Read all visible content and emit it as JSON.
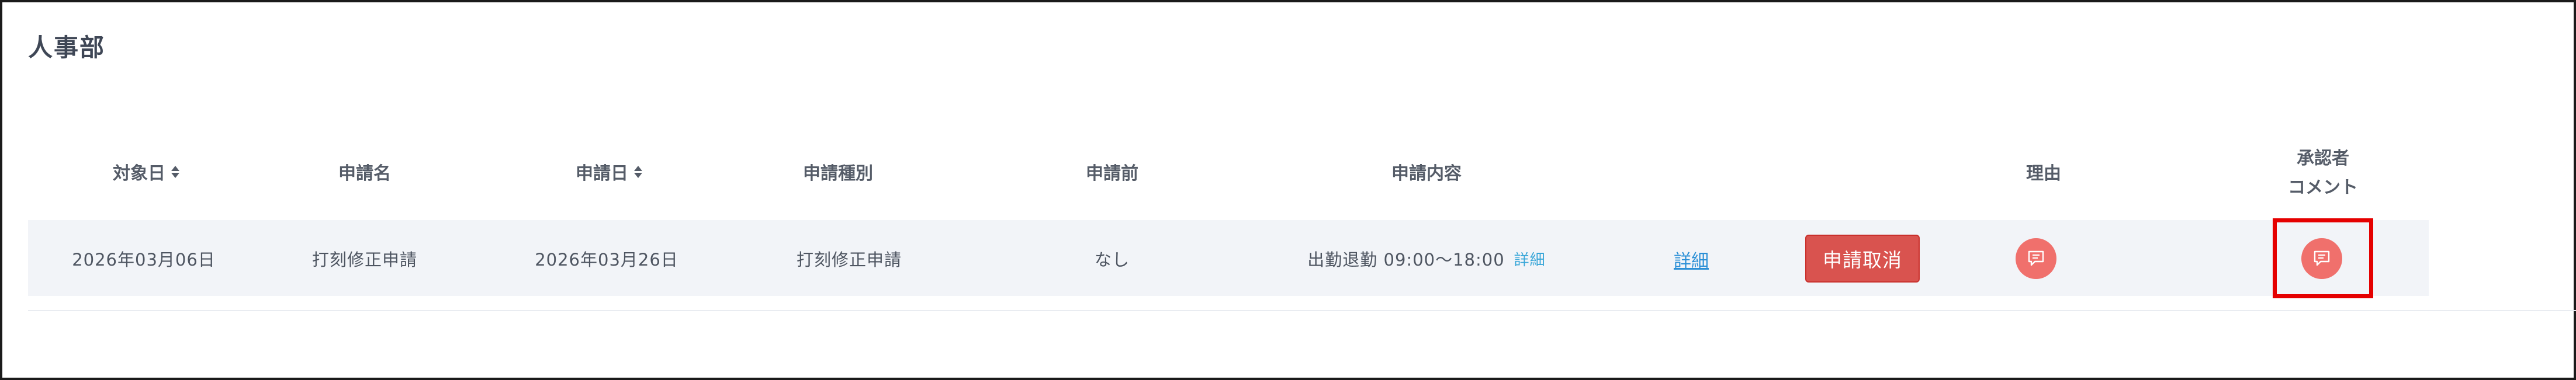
{
  "section_title": "人事部",
  "table": {
    "headers": {
      "target_date": "対象日",
      "request_name": "申請名",
      "request_date": "申請日",
      "request_type": "申請種別",
      "before_request": "申請前",
      "request_content": "申請内容",
      "reason": "理由",
      "approver_comment_line1": "承認者",
      "approver_comment_line2": "コメント"
    },
    "rows": [
      {
        "target_date": "2026年03月06日",
        "request_name": "打刻修正申請",
        "request_date": "2026年03月26日",
        "request_type": "打刻修正申請",
        "before_request": "なし",
        "request_content": "出勤退勤 09:00～18:00",
        "content_detail_link": "詳細",
        "detail_link": "詳細",
        "cancel_button": "申請取消"
      }
    ]
  },
  "colors": {
    "cancel_button": "#d9534f",
    "comment_icon_bg": "#f0706c",
    "highlight": "#e50000",
    "link": "#2b8fd6",
    "row_background": "#f2f4f8"
  },
  "icons": {
    "sort": "sort-icon",
    "reason": "message-icon",
    "approver_comment": "message-icon"
  }
}
